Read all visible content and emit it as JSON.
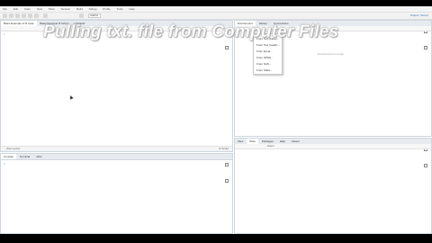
{
  "menubar": {
    "items": [
      "File",
      "Edit",
      "Code",
      "View",
      "Plots",
      "Session",
      "Build",
      "Debug",
      "Profile",
      "Tools",
      "Help"
    ]
  },
  "toolbar": {
    "addins_label": "Addins",
    "project_label": "Project: (None)"
  },
  "editor": {
    "tabs": [
      "Basic Example of R code",
      "Basic Example R Script",
      "Untitled1"
    ],
    "status_left": "(Top Level)",
    "status_right": "R Script"
  },
  "environment": {
    "tabs": [
      "Environment",
      "History",
      "Connections"
    ],
    "empty_message": "Environment is empty"
  },
  "import_menu": {
    "items": [
      "From Text (base)...",
      "From Text (readr)...",
      "From Excel...",
      "From SPSS...",
      "From SAS...",
      "From Stata..."
    ]
  },
  "console": {
    "tabs": [
      "Console",
      "Terminal",
      "Jobs"
    ],
    "prompt": ">"
  },
  "files_pane": {
    "tabs": [
      "Files",
      "Plots",
      "Packages",
      "Help",
      "Viewer"
    ],
    "zoom_label": "Zoom"
  },
  "overlay": {
    "title": "Pulling txt. file from Computer Files"
  },
  "colors": {
    "letterbox": "#000000",
    "pane_border": "#cfd6df",
    "tab_bar": "#e7ebf0",
    "accent": "#3a6fb0"
  }
}
